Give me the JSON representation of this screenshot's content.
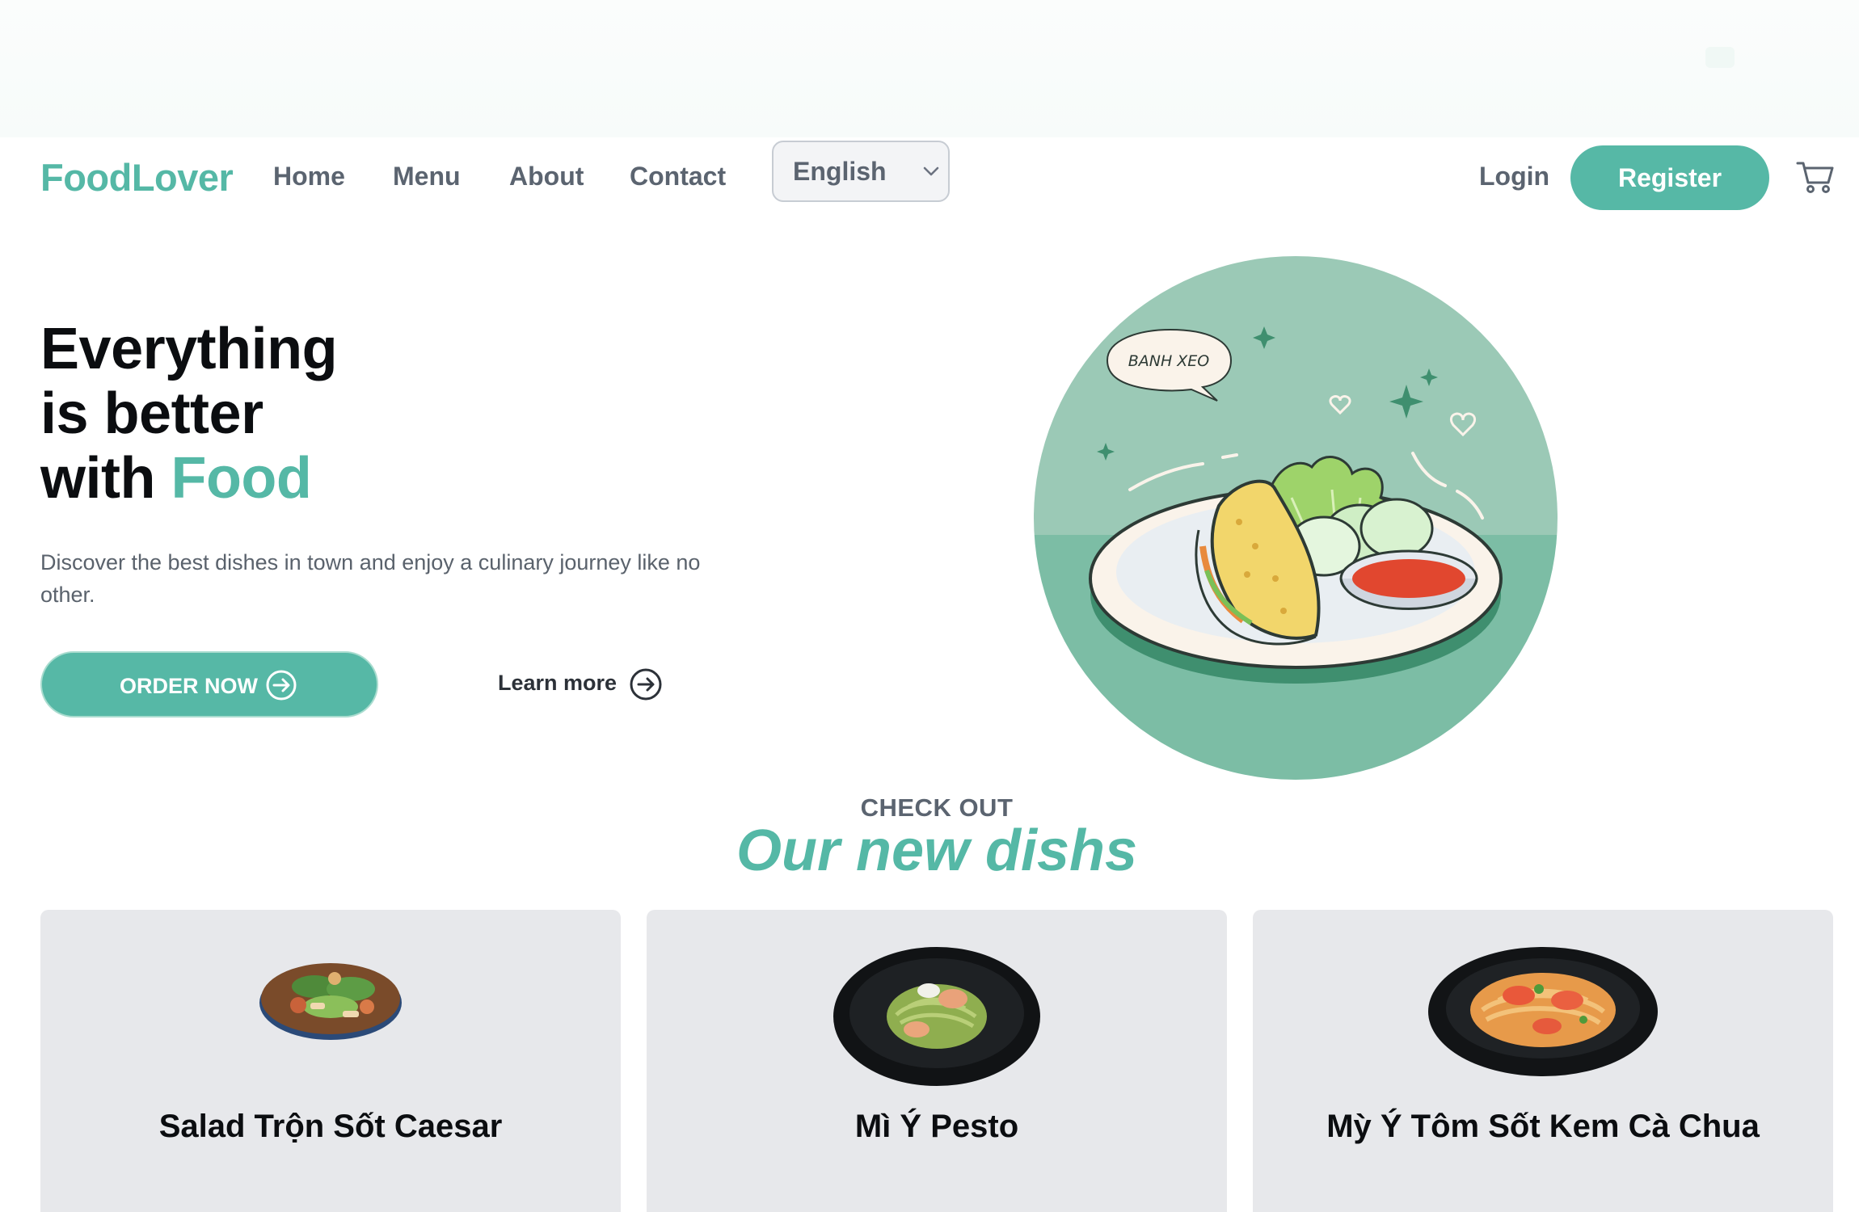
{
  "nav": {
    "logo": "FoodLover",
    "links": [
      "Home",
      "Menu",
      "About",
      "Contact"
    ],
    "language": {
      "selected": "English"
    },
    "login": "Login",
    "register": "Register",
    "cart_icon": "cart-icon"
  },
  "hero": {
    "title_line1": "Everything",
    "title_line2": "is better",
    "title_line3_prefix": "with ",
    "title_line3_accent": "Food",
    "description": "Discover the best dishes in town and enjoy a culinary journey like no other.",
    "order_button": "ORDER NOW",
    "learn_more": "Learn more",
    "illustration_caption": "BANH XEO"
  },
  "section": {
    "kicker": "CHECK OUT",
    "title": "Our new dishs",
    "dishes": [
      {
        "name": "Salad Trộn Sốt Caesar"
      },
      {
        "name": "Mì Ý Pesto"
      },
      {
        "name": "Mỳ Ý Tôm Sốt Kem Cà Chua"
      }
    ]
  },
  "colors": {
    "accent": "#56b8a6",
    "text_dark": "#0b0d10",
    "text_muted": "#5b6470",
    "card_bg": "#e7e8eb"
  }
}
